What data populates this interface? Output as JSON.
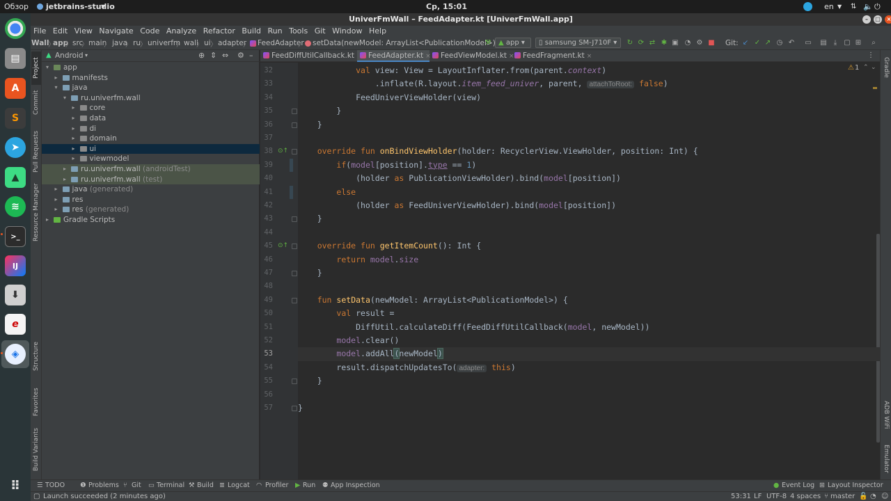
{
  "topbar": {
    "activities": "Обзор",
    "app_menu": "jetbrains-studio",
    "clock": "Ср, 15:01",
    "lang": "en"
  },
  "window": {
    "title": "UniverFmWall – FeedAdapter.kt [UniverFmWall.app]"
  },
  "menu": [
    "File",
    "Edit",
    "View",
    "Navigate",
    "Code",
    "Analyze",
    "Refactor",
    "Build",
    "Run",
    "Tools",
    "Git",
    "Window",
    "Help"
  ],
  "breadcrumbs": [
    "Wall",
    "app",
    "src",
    "main",
    "java",
    "ru",
    "univerfm",
    "wall",
    "ui",
    "adapter",
    "FeedAdapter",
    "setData(newModel: ArrayList<PublicationModel>)"
  ],
  "toolbar": {
    "run_config": "app",
    "device": "samsung SM-J710F",
    "git_label": "Git:"
  },
  "project_panel": {
    "view_mode": "Android",
    "tree": [
      {
        "label": "app",
        "suffix": ""
      },
      {
        "label": "manifests",
        "suffix": ""
      },
      {
        "label": "java",
        "suffix": ""
      },
      {
        "label": "ru.univerfm.wall",
        "suffix": ""
      },
      {
        "label": "core",
        "suffix": ""
      },
      {
        "label": "data",
        "suffix": ""
      },
      {
        "label": "di",
        "suffix": ""
      },
      {
        "label": "domain",
        "suffix": ""
      },
      {
        "label": "ui",
        "suffix": ""
      },
      {
        "label": "viewmodel",
        "suffix": ""
      },
      {
        "label": "ru.univerfm.wall",
        "suffix": "(androidTest)"
      },
      {
        "label": "ru.univerfm.wall",
        "suffix": "(test)"
      },
      {
        "label": "java",
        "suffix": "(generated)"
      },
      {
        "label": "res",
        "suffix": ""
      },
      {
        "label": "res",
        "suffix": "(generated)"
      },
      {
        "label": "Gradle Scripts",
        "suffix": ""
      }
    ]
  },
  "left_tool_tabs": [
    "Project",
    "Commit",
    "Pull Requests",
    "Resource Manager",
    "Structure",
    "Favorites",
    "Build Variants"
  ],
  "right_tool_tabs": [
    "Gradle",
    "ADB WiFi",
    "Emulator"
  ],
  "editor_tabs": [
    "FeedDiffUtilCallback.kt",
    "FeedAdapter.kt",
    "FeedViewModel.kt",
    "FeedFragment.kt"
  ],
  "editor": {
    "warnings": "1",
    "line_numbers": [
      "32",
      "33",
      "34",
      "35",
      "36",
      "37",
      "38",
      "39",
      "40",
      "41",
      "42",
      "43",
      "44",
      "45",
      "46",
      "47",
      "48",
      "49",
      "50",
      "51",
      "52",
      "53",
      "54",
      "55",
      "56",
      "57"
    ],
    "lines": {
      "l32": [
        "            ",
        "val",
        " view: View = LayoutInflater.from(parent.",
        "context",
        ")"
      ],
      "l33": [
        "                .inflate(R.layout.",
        "item_feed_univer",
        ", parent, ",
        "attachToRoot:",
        " ",
        "false",
        ")"
      ],
      "l34": [
        "            FeedUniverViewHolder(view)"
      ],
      "l35": [
        "        }"
      ],
      "l36": [
        "    }"
      ],
      "l37": [
        ""
      ],
      "l38": [
        "    ",
        "override fun",
        " ",
        "onBindViewHolder",
        "(holder: RecyclerView.ViewHolder, position: Int) {"
      ],
      "l39": [
        "        ",
        "if",
        "(",
        "model",
        "[position].",
        "type",
        " == ",
        "1",
        ")"
      ],
      "l40": [
        "            (holder ",
        "as",
        " PublicationViewHolder).bind(",
        "model",
        "[position])"
      ],
      "l41": [
        "        ",
        "else"
      ],
      "l42": [
        "            (holder ",
        "as",
        " FeedUniverViewHolder).bind(",
        "model",
        "[position])"
      ],
      "l43": [
        "    }"
      ],
      "l44": [
        ""
      ],
      "l45": [
        "    ",
        "override fun",
        " ",
        "getItemCount",
        "(): Int {"
      ],
      "l46": [
        "        ",
        "return",
        " ",
        "model",
        ".",
        "size"
      ],
      "l47": [
        "    }"
      ],
      "l48": [
        ""
      ],
      "l49": [
        "    ",
        "fun",
        " ",
        "setData",
        "(newModel: ArrayList<PublicationModel>) {"
      ],
      "l50": [
        "        ",
        "val",
        " result ="
      ],
      "l51": [
        "            DiffUtil.calculateDiff(FeedDiffUtilCallback(",
        "model",
        ", newModel))"
      ],
      "l52": [
        "        ",
        "model",
        ".clear()"
      ],
      "l53": [
        "        ",
        "model",
        ".addAll",
        "(",
        "newModel",
        ")"
      ],
      "l54": [
        "        result.dispatchUpdatesTo(",
        "adapter:",
        " ",
        "this",
        ")"
      ],
      "l55": [
        "    }"
      ],
      "l56": [
        ""
      ],
      "l57": [
        "}"
      ]
    }
  },
  "tool_windows": [
    "TODO",
    "Problems",
    "Git",
    "Terminal",
    "Build",
    "Logcat",
    "Profiler",
    "Run",
    "App Inspection",
    "Event Log",
    "Layout Inspector"
  ],
  "status": {
    "message": "Launch succeeded (2 minutes ago)",
    "position": "53:31",
    "line_sep": "LF",
    "encoding": "UTF-8",
    "indent": "4 spaces",
    "branch": "master"
  }
}
